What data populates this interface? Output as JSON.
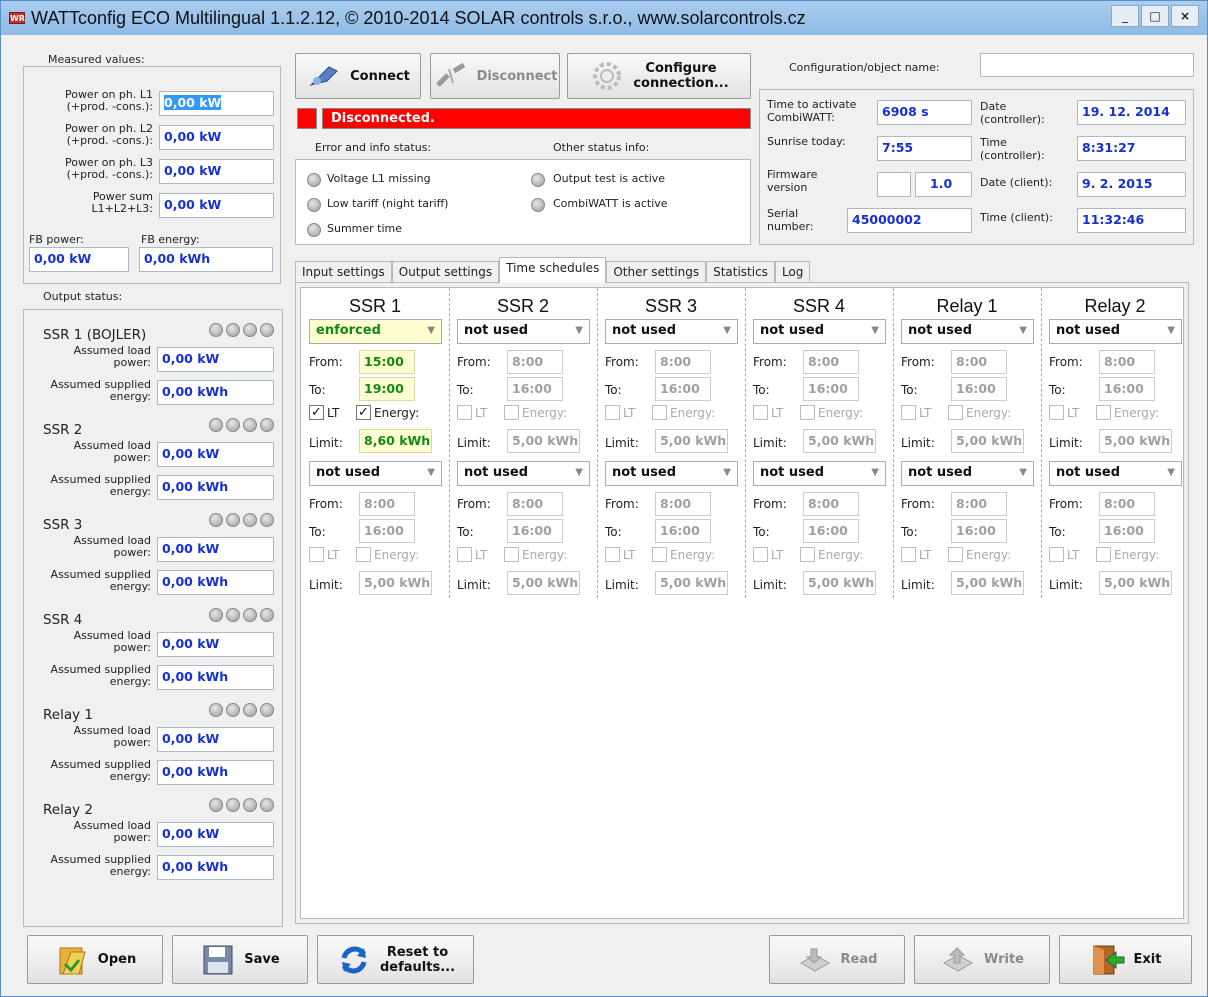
{
  "window": {
    "title": "WATTconfig ECO Multilingual 1.1.2.12, © 2010-2014 SOLAR controls s.r.o., www.solarcontrols.cz",
    "icon_text": "WR",
    "controls": [
      "_",
      "□",
      "×"
    ]
  },
  "measured": {
    "title": "Measured values:",
    "rows": [
      {
        "label1": "Power on ph. L1",
        "label2": "(+prod. -cons.):",
        "value": "0,00 kW"
      },
      {
        "label1": "Power on ph. L2",
        "label2": "(+prod. -cons.):",
        "value": "0,00 kW"
      },
      {
        "label1": "Power on ph. L3",
        "label2": "(+prod. -cons.):",
        "value": "0,00 kW"
      },
      {
        "label1": "Power sum",
        "label2": "L1+L2+L3:",
        "value": "0,00 kW"
      }
    ],
    "fb_power_label": "FB power:",
    "fb_power_value": "0,00 kW",
    "fb_energy_label": "FB energy:",
    "fb_energy_value": "0,00 kWh"
  },
  "output_status": {
    "title": "Output status:",
    "load_label1": "Assumed load",
    "load_label2": "power:",
    "energy_label1": "Assumed supplied",
    "energy_label2": "energy:",
    "items": [
      {
        "name": "SSR 1 (BOJLER)",
        "power": "0,00 kW",
        "energy": "0,00 kWh"
      },
      {
        "name": "SSR 2",
        "power": "0,00 kW",
        "energy": "0,00 kWh"
      },
      {
        "name": "SSR 3",
        "power": "0,00 kW",
        "energy": "0,00 kWh"
      },
      {
        "name": "SSR 4",
        "power": "0,00 kW",
        "energy": "0,00 kWh"
      },
      {
        "name": "Relay 1",
        "power": "0,00 kW",
        "energy": "0,00 kWh"
      },
      {
        "name": "Relay 2",
        "power": "0,00 kW",
        "energy": "0,00 kWh"
      }
    ]
  },
  "toolbar": {
    "connect": "Connect",
    "disconnect": "Disconnect",
    "configure1": "Configure",
    "configure2": "connection..."
  },
  "status": {
    "bar_text": "Disconnected.",
    "error_title": "Error and info status:",
    "other_title": "Other status info:",
    "error_items": [
      "Voltage L1 missing",
      "Low tariff (night tariff)",
      "Summer time"
    ],
    "other_items": [
      "Output test is active",
      "CombiWATT is active"
    ]
  },
  "config": {
    "name_label": "Configuration/object name:",
    "name_value": "",
    "time_activate_label1": "Time to activate",
    "time_activate_label2": "CombiWATT:",
    "time_activate_value": "6908 s",
    "sunrise_label": "Sunrise today:",
    "sunrise_value": "7:55",
    "firmware_label1": "Firmware",
    "firmware_label2": "version",
    "firmware_value": "1.0",
    "serial_label1": "Serial",
    "serial_label2": "number:",
    "serial_value": "45000002",
    "date_ctrl_label1": "Date",
    "date_ctrl_label2": "(controller):",
    "date_ctrl_value": "19. 12. 2014",
    "time_ctrl_label1": "Time",
    "time_ctrl_label2": "(controller):",
    "time_ctrl_value": "8:31:27",
    "date_client_label": "Date (client):",
    "date_client_value": "9. 2. 2015",
    "time_client_label": "Time (client):",
    "time_client_value": "11:32:46"
  },
  "tabs": [
    "Input settings",
    "Output settings",
    "Time schedules",
    "Other settings",
    "Statistics",
    "Log"
  ],
  "active_tab": "Time schedules",
  "schedule": {
    "from_label": "From:",
    "to_label": "To:",
    "limit_label": "Limit:",
    "lt_label": "LT",
    "energy_label": "Energy:",
    "columns": [
      {
        "name": "SSR 1",
        "s1": {
          "mode": "enforced",
          "from": "15:00",
          "to": "19:00",
          "lt": true,
          "energy": true,
          "limit": "8,60 kWh",
          "active": true
        },
        "s2": {
          "mode": "not used",
          "from": "8:00",
          "to": "16:00",
          "lt": false,
          "energy": false,
          "limit": "5,00 kWh",
          "active": false
        }
      },
      {
        "name": "SSR 2",
        "s1": {
          "mode": "not used",
          "from": "8:00",
          "to": "16:00",
          "lt": false,
          "energy": false,
          "limit": "5,00 kWh",
          "active": false
        },
        "s2": {
          "mode": "not used",
          "from": "8:00",
          "to": "16:00",
          "lt": false,
          "energy": false,
          "limit": "5,00 kWh",
          "active": false
        }
      },
      {
        "name": "SSR 3",
        "s1": {
          "mode": "not used",
          "from": "8:00",
          "to": "16:00",
          "lt": false,
          "energy": false,
          "limit": "5,00 kWh",
          "active": false
        },
        "s2": {
          "mode": "not used",
          "from": "8:00",
          "to": "16:00",
          "lt": false,
          "energy": false,
          "limit": "5,00 kWh",
          "active": false
        }
      },
      {
        "name": "SSR 4",
        "s1": {
          "mode": "not used",
          "from": "8:00",
          "to": "16:00",
          "lt": false,
          "energy": false,
          "limit": "5,00 kWh",
          "active": false
        },
        "s2": {
          "mode": "not used",
          "from": "8:00",
          "to": "16:00",
          "lt": false,
          "energy": false,
          "limit": "5,00 kWh",
          "active": false
        }
      },
      {
        "name": "Relay 1",
        "s1": {
          "mode": "not used",
          "from": "8:00",
          "to": "16:00",
          "lt": false,
          "energy": false,
          "limit": "5,00 kWh",
          "active": false
        },
        "s2": {
          "mode": "not used",
          "from": "8:00",
          "to": "16:00",
          "lt": false,
          "energy": false,
          "limit": "5,00 kWh",
          "active": false
        }
      },
      {
        "name": "Relay 2",
        "s1": {
          "mode": "not used",
          "from": "8:00",
          "to": "16:00",
          "lt": false,
          "energy": false,
          "limit": "5,00 kWh",
          "active": false
        },
        "s2": {
          "mode": "not used",
          "from": "8:00",
          "to": "16:00",
          "lt": false,
          "energy": false,
          "limit": "5,00 kWh",
          "active": false
        }
      }
    ]
  },
  "bottom": {
    "open": "Open",
    "save": "Save",
    "reset1": "Reset to",
    "reset2": "defaults...",
    "read": "Read",
    "write": "Write",
    "exit": "Exit"
  },
  "colors": {
    "value_text": "#1430d6",
    "active_text": "#128a12",
    "active_bg": "#ffffd2",
    "disconnected_bar": "#ff0000",
    "titlebar": "#8fbbe6"
  }
}
